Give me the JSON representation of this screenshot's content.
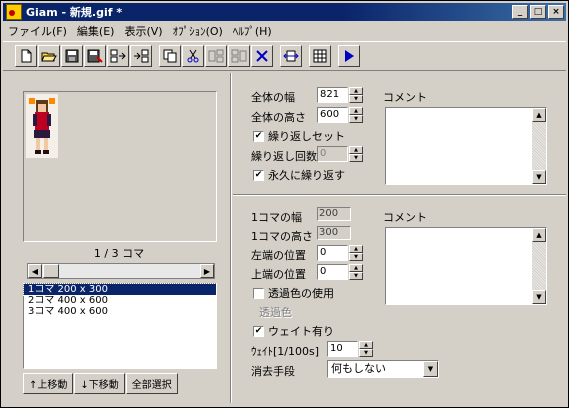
{
  "window": {
    "title": "Giam - 新規.gif *",
    "min": "_",
    "max": "□",
    "close": "×"
  },
  "menu": [
    "ファイル(F)",
    "編集(E)",
    "表示(V)",
    "ｵﾌﾟｼｮﾝ(O)",
    "ﾍﾙﾌﾟ(H)"
  ],
  "toolbar": {
    "icons": [
      "new-file-icon",
      "open-folder-icon",
      "save-icon",
      "save-as-icon",
      "import-frames-icon",
      "export-frames-icon",
      "copy-icon",
      "cut-icon",
      "paste-before-icon",
      "paste-after-icon",
      "delete-icon",
      "frame-size-icon",
      "grid-icon",
      "play-icon"
    ]
  },
  "left": {
    "frame_counter": "1 / 3 コマ",
    "frames": [
      "1コマ 200 x 300",
      "2コマ 400 x 600",
      "3コマ 400 x 600"
    ],
    "selected_frame": 0,
    "buttons": {
      "up": "↑上移動",
      "down": "↓下移動",
      "select_all": "全部選択"
    }
  },
  "global": {
    "width_label": "全体の幅",
    "width_value": "821",
    "height_label": "全体の高さ",
    "height_value": "600",
    "loop_set_label": "繰り返しセット",
    "loop_count_label": "繰り返し回数",
    "loop_count_value": "0",
    "loop_forever_label": "永久に繰り返す",
    "comment_label": "コメント",
    "loop_set_checked": true,
    "loop_forever_checked": true
  },
  "frame": {
    "width_label": "1コマの幅",
    "width_value": "200",
    "height_label": "1コマの高さ",
    "height_value": "300",
    "left_label": "左端の位置",
    "left_value": "0",
    "top_label": "上端の位置",
    "top_value": "0",
    "transparent_label": "透過色の使用",
    "transparent_color_label": "透過色",
    "wait_label": "ウェイト有り",
    "wait_value_label": "ｳｪｲﾄ[1/100s]",
    "wait_value": "10",
    "dispose_label": "消去手段",
    "dispose_value": "何もしない",
    "comment_label": "コメント",
    "transparent_checked": false,
    "wait_checked": true
  }
}
